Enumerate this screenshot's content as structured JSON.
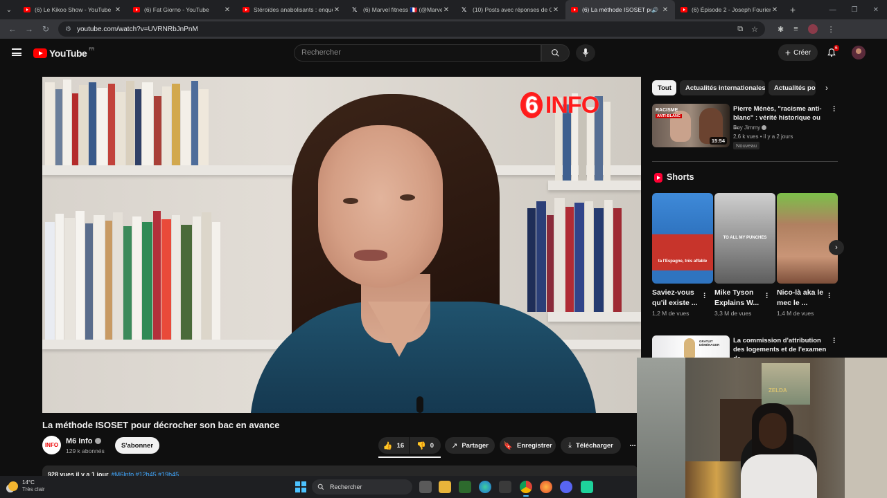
{
  "browser": {
    "tabs": [
      {
        "title": "(6) Le Kikoo Show - YouTube",
        "icon": "youtube-icon",
        "active": false
      },
      {
        "title": "(6) Fat Giorno - YouTube",
        "icon": "youtube-icon",
        "active": false
      },
      {
        "title": "Stéroïdes anabolisants : enquête",
        "icon": "youtube-icon",
        "active": false
      },
      {
        "title": "(6) Marvel fitness 🇫🇷 (@Marvel_",
        "icon": "x-icon",
        "active": false
      },
      {
        "title": "(10) Posts avec réponses de Ch",
        "icon": "x-icon",
        "active": false
      },
      {
        "title": "(6) La méthode ISOSET pou",
        "icon": "youtube-icon",
        "active": true
      },
      {
        "title": "(6) Épisode 2 - Joseph Fourier",
        "icon": "youtube-icon",
        "active": false
      }
    ],
    "url": "youtube.com/watch?v=UVRNRbJnPnM"
  },
  "youtube": {
    "logo_text": "YouTube",
    "country": "FR",
    "search_placeholder": "Rechercher",
    "create_label": "Créer",
    "notifications_count": "6"
  },
  "video": {
    "overlay_logo_num": "6",
    "overlay_logo_text": "INFO",
    "title": "La méthode ISOSET pour décrocher son bac en avance",
    "channel": {
      "avatar_text": "INFO",
      "name": "M6 Info",
      "subscribers": "129 k abonnés",
      "subscribe_label": "S'abonner"
    },
    "actions": {
      "likes": "16",
      "dislikes": "0",
      "share": "Partager",
      "save": "Enregistrer",
      "download": "Télécharger"
    },
    "description": {
      "stats": "928 vues  il y a 1 jour",
      "tags": "#M6Info #12h45 #19h45"
    }
  },
  "sidebar": {
    "chips": [
      "Tout",
      "Actualités internationales",
      "Actualités po"
    ],
    "rec1": {
      "thumb_text_1": "RACISME",
      "thumb_text_2": "ANTI-BLANC",
      "duration": "15:54",
      "title": "Pierre Ménès, \"racisme anti-blanc\" : vérité historique ou ...",
      "channel": "Boy Jimmy",
      "meta": "2,6 k vues • il y a 2 jours",
      "badge": "Nouveau"
    },
    "shorts_heading": "Shorts",
    "shorts": [
      {
        "thumb_caption": "ta l'Espagne, très affable",
        "title": "Saviez-vous qu'il existe ...",
        "views": "1,2 M de vues"
      },
      {
        "thumb_caption": "TO ALL MY PUNCHES",
        "title": "Mike Tyson Explains W...",
        "views": "3,3 M de vues"
      },
      {
        "thumb_caption": "",
        "title": "Nico-là aka le mec le ...",
        "views": "1,4 M de vues"
      }
    ],
    "rec2": {
      "thumb_label": "GRATUIT DÉMÉNAGER",
      "title": "La commission d'attribution des logements et de l'examen de ..."
    }
  },
  "webcam": {
    "poster_text": "ZELDA"
  },
  "taskbar": {
    "temperature": "14°C",
    "weather": "Très clair",
    "search_label": "Rechercher"
  }
}
